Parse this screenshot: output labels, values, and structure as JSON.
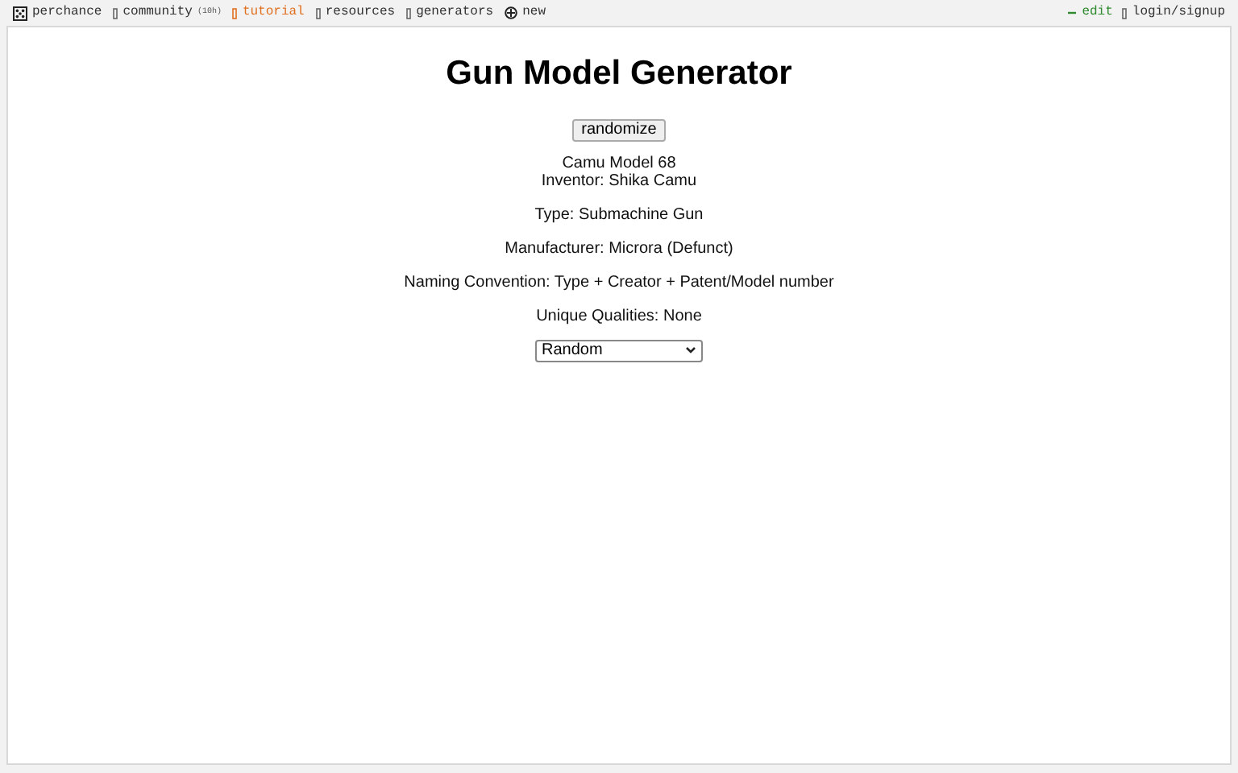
{
  "nav_left": [
    {
      "kind": "logo",
      "label": "perchance",
      "color": "#333333"
    },
    {
      "kind": "link",
      "label": "community",
      "badge": "(10h)",
      "color": "#333333"
    },
    {
      "kind": "link",
      "label": "tutorial",
      "color": "#e07020"
    },
    {
      "kind": "link",
      "label": "resources",
      "color": "#333333"
    },
    {
      "kind": "link",
      "label": "generators",
      "color": "#333333"
    },
    {
      "kind": "new",
      "label": "new",
      "color": "#333333"
    }
  ],
  "nav_right": [
    {
      "kind": "edit",
      "label": "edit",
      "color": "#2e8b2e"
    },
    {
      "kind": "link",
      "label": "login/signup",
      "color": "#333333"
    }
  ],
  "title": "Gun Model Generator",
  "button": "randomize",
  "paragraphs": [
    [
      "Camu Model 68",
      "Inventor: Shika Camu"
    ],
    [
      "Type: Submachine Gun"
    ],
    [
      "Manufacturer: Microra (Defunct)"
    ],
    [
      "Naming Convention: Type + Creator + Patent/Model number"
    ],
    [
      "Unique Qualities: None"
    ]
  ],
  "select": {
    "value": "Random"
  }
}
